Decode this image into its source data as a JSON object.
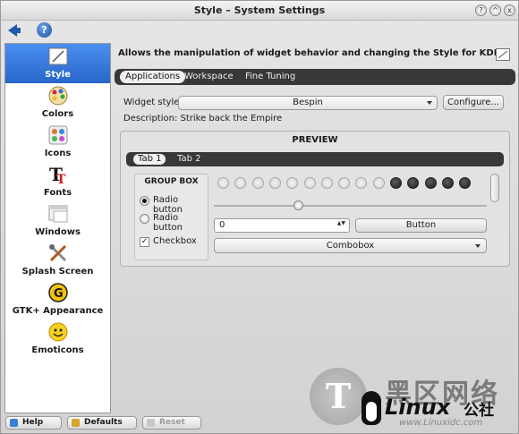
{
  "window": {
    "title": "Style – System Settings",
    "controls": [
      "?",
      "^",
      "x"
    ]
  },
  "toolbar": {
    "back_icon": "back-arrow-icon",
    "help_icon": "help-icon",
    "help_glyph": "?"
  },
  "sidebar": {
    "items": [
      {
        "label": "Style",
        "icon": "style-icon",
        "active": true
      },
      {
        "label": "Colors",
        "icon": "colors-icon"
      },
      {
        "label": "Icons",
        "icon": "icons-icon"
      },
      {
        "label": "Fonts",
        "icon": "fonts-icon"
      },
      {
        "label": "Windows",
        "icon": "windows-icon"
      },
      {
        "label": "Splash Screen",
        "icon": "splash-screen-icon"
      },
      {
        "label": "GTK+ Appearance",
        "icon": "gtk-icon"
      },
      {
        "label": "Emoticons",
        "icon": "emoticons-icon"
      }
    ]
  },
  "main": {
    "header": "Allows the manipulation of widget behavior and changing the Style for KDE",
    "tabs": [
      {
        "label": "Applications",
        "active": true
      },
      {
        "label": "Workspace"
      },
      {
        "label": "Fine Tuning"
      }
    ],
    "widget_style_label": "Widget style:",
    "widget_style_value": "Bespin",
    "configure_label": "Configure...",
    "description": "Description: Strike back the Empire"
  },
  "preview": {
    "title": "PREVIEW",
    "tabs": [
      {
        "label": "Tab 1",
        "active": true
      },
      {
        "label": "Tab 2"
      }
    ],
    "group_box": {
      "title": "GROUP BOX",
      "radio1": "Radio button",
      "radio2": "Radio button",
      "checkbox": "Checkbox",
      "checkbox_mark": "✓"
    },
    "progress_dots": {
      "total": 15,
      "filled": 5
    },
    "slider_value": 0.31,
    "spinbox_value": "0",
    "spin_arrows": "▲▼",
    "button_label": "Button",
    "combobox_label": "Combobox"
  },
  "bottom": {
    "help": "Help",
    "defaults": "Defaults",
    "reset": "Reset"
  },
  "watermark": {
    "glyph": "T",
    "cn_text": "黑区网络",
    "linux_text": "Linux",
    "gs_text": "公社",
    "url": "www.Linuxidc.com"
  },
  "colors": {
    "accent": "#2f74dc",
    "tab_dark": "#383838"
  }
}
